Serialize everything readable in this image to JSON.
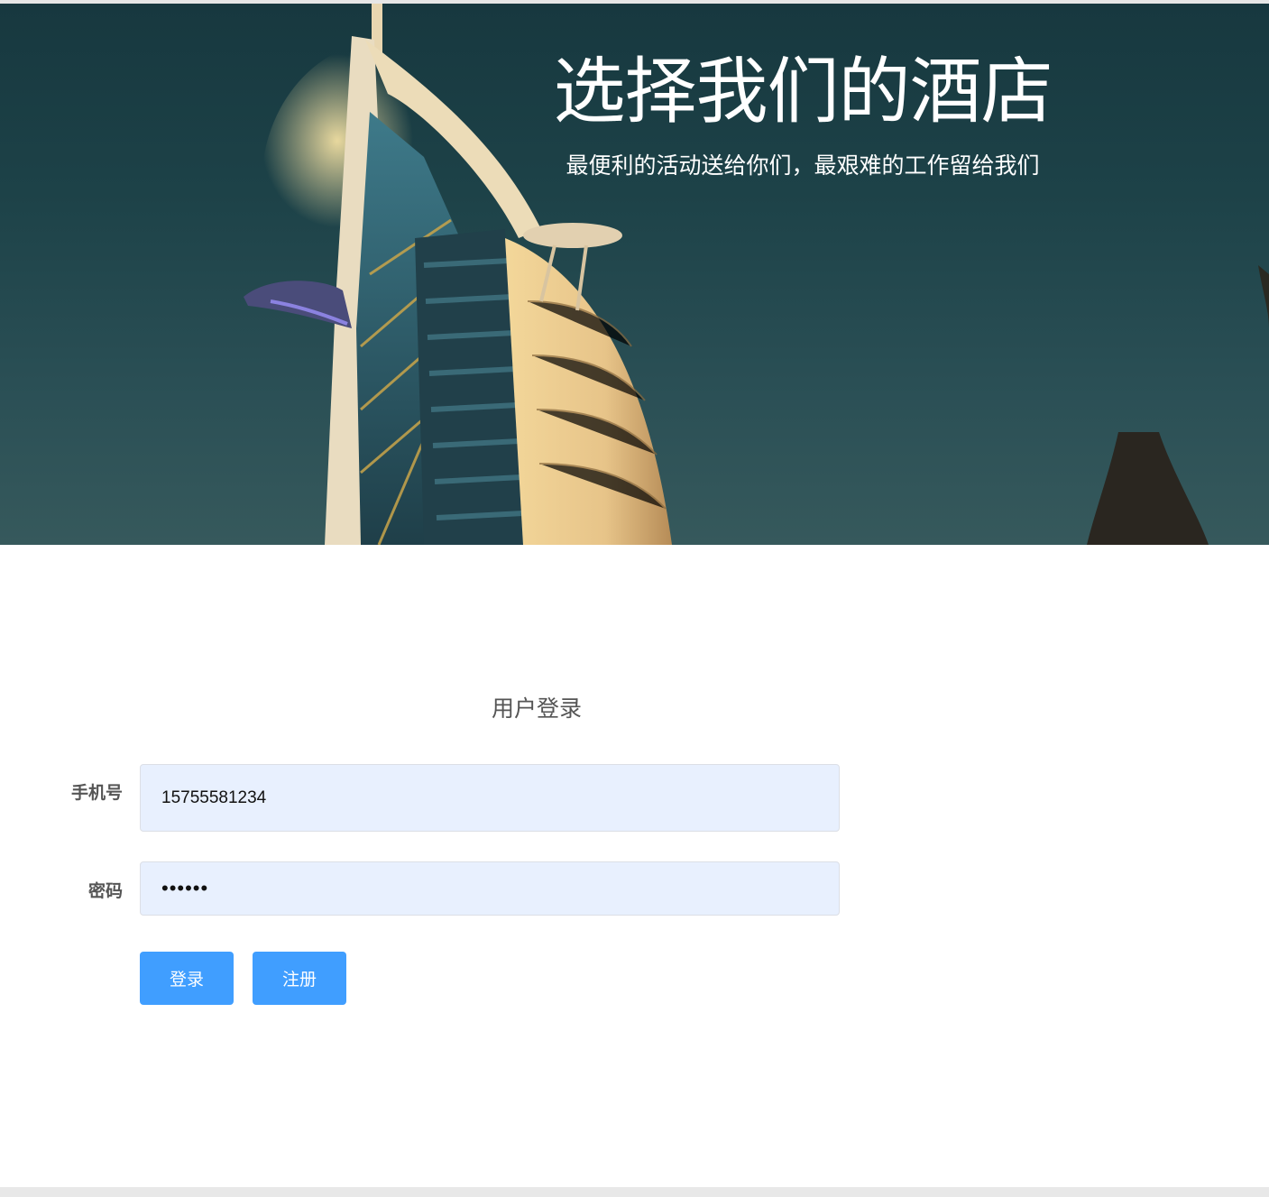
{
  "hero": {
    "title": "选择我们的酒店",
    "subtitle": "最便利的活动送给你们，最艰难的工作留给我们",
    "image": "burj-al-arab-hotel-at-dusk"
  },
  "login": {
    "title": "用户登录",
    "phone_label": "手机号",
    "phone_value": "15755581234",
    "password_label": "密码",
    "password_value": "••••••",
    "login_button": "登录",
    "register_button": "注册"
  },
  "colors": {
    "primary_button": "#409eff",
    "input_autofill_bg": "#e8f0fe",
    "label_text": "#555555"
  }
}
